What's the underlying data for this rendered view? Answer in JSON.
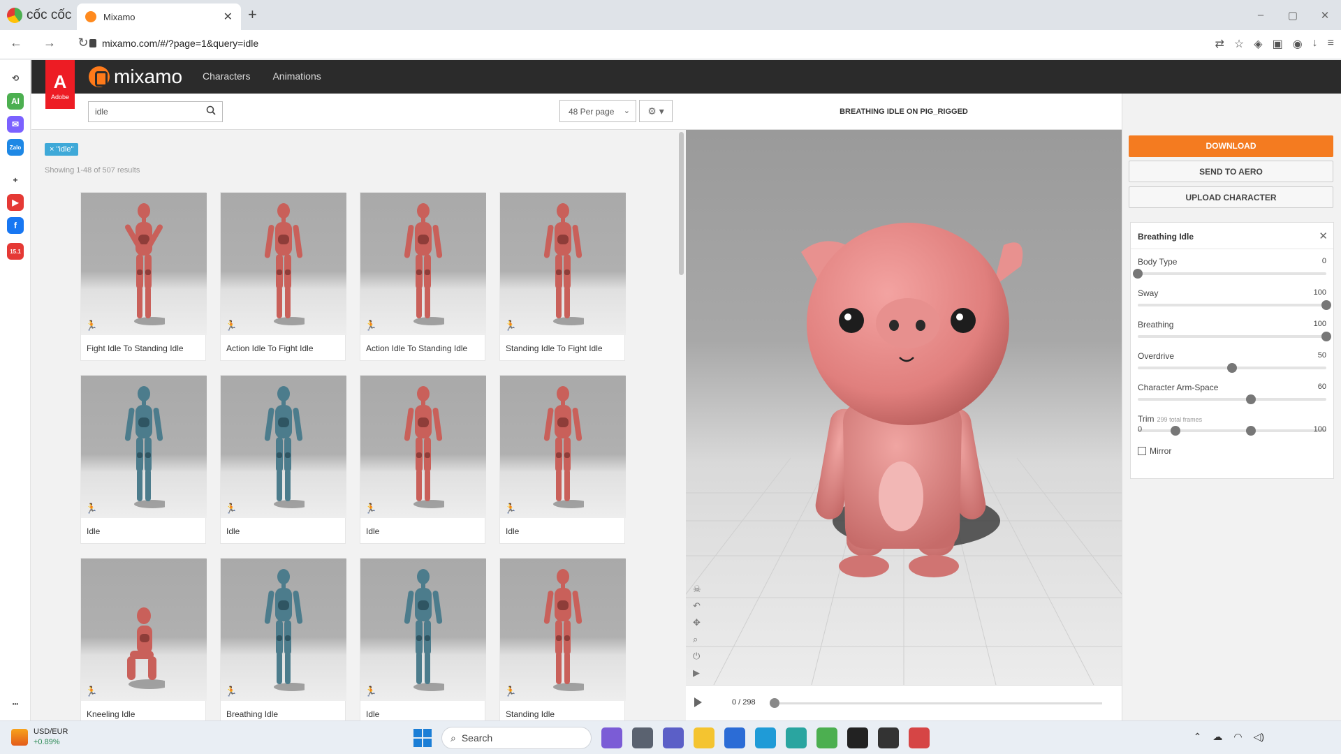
{
  "browser": {
    "brand": "cốc cốc",
    "tab_title": "Mixamo",
    "tab_close": "✕",
    "new_tab": "+",
    "url": "mixamo.com/#/?page=1&query=idle",
    "nav": {
      "back": "←",
      "forward": "→",
      "reload": "↻"
    },
    "window_controls": {
      "minimize": "–",
      "maximize": "▢",
      "close": "✕"
    },
    "toolbar_icons": [
      "translate-icon",
      "star-icon",
      "shield-icon",
      "extensions-icon",
      "profile-icon",
      "download-icon",
      "menu-icon"
    ]
  },
  "browser_sidebar": {
    "items": [
      {
        "name": "history-icon",
        "glyph": "⟲",
        "color": "#ffffff",
        "text_color": "#555555"
      },
      {
        "name": "ai-icon",
        "glyph": "AI",
        "color": "#4caf50"
      },
      {
        "name": "messenger-icon",
        "glyph": "✉",
        "color": "#7b61ff"
      },
      {
        "name": "zalo-icon",
        "glyph": "Zalo",
        "color": "#1e88e5"
      },
      {
        "name": "add-icon",
        "glyph": "+",
        "color": "#ffffff",
        "text_color": "#333333"
      },
      {
        "name": "youtube-icon",
        "glyph": "▶",
        "color": "#e53935"
      },
      {
        "name": "facebook-icon",
        "glyph": "f",
        "color": "#1877f2"
      },
      {
        "name": "shopping-icon",
        "glyph": "15.1",
        "color": "#e53935"
      },
      {
        "name": "more-icon",
        "glyph": "•••",
        "color": "#ffffff",
        "text_color": "#333333"
      }
    ]
  },
  "mixamo": {
    "adobe": {
      "mark": "A",
      "text": "Adobe"
    },
    "wordmark": "mixamo",
    "nav": [
      "Characters",
      "Animations"
    ]
  },
  "search": {
    "value": "idle",
    "per_page": "48 Per page",
    "chip": "× \"idle\"",
    "count": "Showing 1-48 of 507 results"
  },
  "cards": [
    {
      "label": "Fight Idle To Standing Idle",
      "color": "#c9605a",
      "pose": "fight"
    },
    {
      "label": "Action Idle To Fight Idle",
      "color": "#c9605a",
      "pose": "stand"
    },
    {
      "label": "Action Idle To Standing Idle",
      "color": "#c9605a",
      "pose": "stand"
    },
    {
      "label": "Standing Idle To Fight Idle",
      "color": "#c9605a",
      "pose": "stand"
    },
    {
      "label": "Idle",
      "color": "#4c7c8c",
      "pose": "stand"
    },
    {
      "label": "Idle",
      "color": "#4c7c8c",
      "pose": "stand"
    },
    {
      "label": "Idle",
      "color": "#c9605a",
      "pose": "stand"
    },
    {
      "label": "Idle",
      "color": "#c9605a",
      "pose": "stand"
    },
    {
      "label": "Kneeling Idle",
      "color": "#c9605a",
      "pose": "kneel"
    },
    {
      "label": "Breathing Idle",
      "color": "#4c7c8c",
      "pose": "stand"
    },
    {
      "label": "Idle",
      "color": "#4c7c8c",
      "pose": "stand"
    },
    {
      "label": "Standing Idle",
      "color": "#c9605a",
      "pose": "stand"
    }
  ],
  "viewer": {
    "title": "BREATHING IDLE ON PIG_RIGGED",
    "frame": "0 / 298",
    "frame_progress": 0,
    "tools": [
      "skeleton-icon",
      "undo-icon",
      "move-icon",
      "zoom-icon",
      "power-icon",
      "camera-icon"
    ]
  },
  "panel": {
    "download": "DOWNLOAD",
    "send_to_aero": "SEND TO AERO",
    "upload": "UPLOAD CHARACTER",
    "anim_title": "Breathing Idle",
    "close": "✕",
    "sliders": [
      {
        "name": "Body Type",
        "value": "0",
        "level": 0
      },
      {
        "name": "Sway",
        "value": "100",
        "level": 1
      },
      {
        "name": "Breathing",
        "value": "100",
        "level": 1
      },
      {
        "name": "Overdrive",
        "value": "50",
        "level": 0.5
      },
      {
        "name": "Character Arm-Space",
        "value": "60",
        "level": 0.6
      }
    ],
    "trim": {
      "name": "Trim",
      "sub": "299 total frames",
      "start": 0.2,
      "end": 0.6,
      "min": "0",
      "max": "100"
    },
    "mirror": "Mirror"
  },
  "taskbar": {
    "pair": "USD/EUR",
    "change": "+0.89%",
    "search": "Search",
    "apps": [
      {
        "name": "widgets-icon",
        "color": "#7b5cd6"
      },
      {
        "name": "task-view-icon",
        "color": "#5a6270"
      },
      {
        "name": "teams-icon",
        "color": "#5b5fc7"
      },
      {
        "name": "file-explorer-icon",
        "color": "#f4c430"
      },
      {
        "name": "store-icon",
        "color": "#2b6cd6"
      },
      {
        "name": "edge-icon",
        "color": "#1f9bd7"
      },
      {
        "name": "mixamo-app-icon",
        "color": "#2aa5a0"
      },
      {
        "name": "coccoc-app-icon",
        "color": "#4caf50"
      },
      {
        "name": "unity-icon",
        "color": "#222222"
      },
      {
        "name": "unity-hub-icon",
        "color": "#333333"
      },
      {
        "name": "snipping-icon",
        "color": "#d64545"
      }
    ],
    "tray": [
      "chevron-up-icon",
      "onedrive-icon",
      "wifi-icon",
      "volume-icon"
    ]
  }
}
